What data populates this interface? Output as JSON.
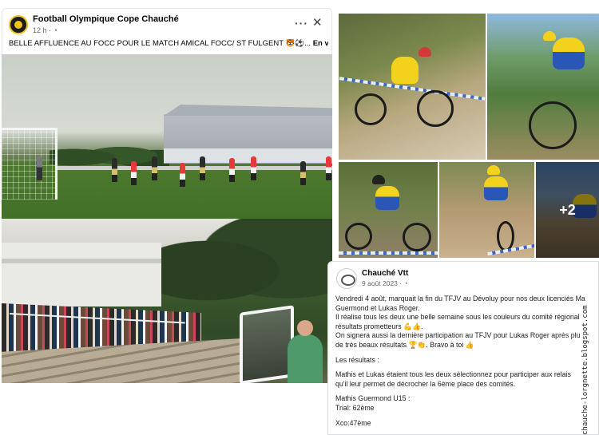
{
  "left_post": {
    "page_name": "Football Olympique Cope Chauché",
    "meta": "12 h · ",
    "globe": "◔",
    "text": "BELLE AFFLUENCE AU FOCC POUR LE MATCH AMICAL FOCC/ ST FULGENT 🐯⚽... ",
    "see_more": "En voir plus",
    "more_icon": "···",
    "close_icon": "✕"
  },
  "right_collage": {
    "overlay_count": "+2"
  },
  "right_post": {
    "name": "Chauché Vtt",
    "date": "9 août 2023 · ",
    "globe": "◔",
    "lines": [
      "Vendredi 4 août, marquait la fin du TFJV au Dévoluy pour nos deux licenciés Ma",
      "Guermond et Lukas Roger.",
      "Il réalise tous les deux une belle semaine sous les couleurs du comité régional",
      "résultats prometteurs 💪👍.",
      "On signera aussi la dernière participation au TFJV pour Lukas Roger après plu",
      "de très beaux résultats 🏆👏. Bravo à toi 👍"
    ],
    "results_title": "Les résultats :",
    "results_lines": [
      "Mathis et Lukas étaient tous les deux sélectionnez pour participer aux relais",
      "qu'il leur permet de décrocher la 6ème place des comités."
    ],
    "athlete": "Mathis Guermond U15 :",
    "trial": "Trial: 62ème",
    "xco": "Xco:47ème"
  },
  "watermark": "chauche-lorgnette.blogspot.com"
}
